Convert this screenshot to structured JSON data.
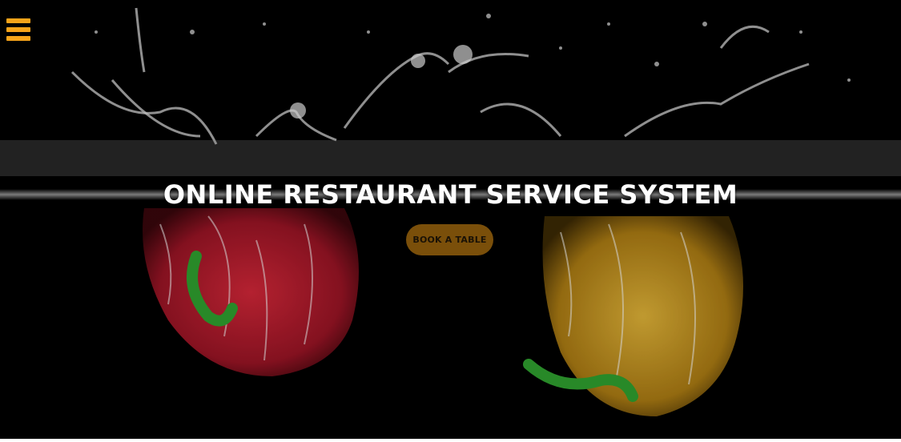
{
  "hero": {
    "title": "ONLINE RESTAURANT SERVICE SYSTEM",
    "book_button_label": "BOOK A TABLE",
    "background_image": "water-splash-peppers"
  },
  "nav": {
    "menu_icon": "hamburger-menu-icon"
  },
  "colors": {
    "accent": "#f5a31a",
    "button_bg": "#7a4f0a",
    "background": "#000000"
  }
}
